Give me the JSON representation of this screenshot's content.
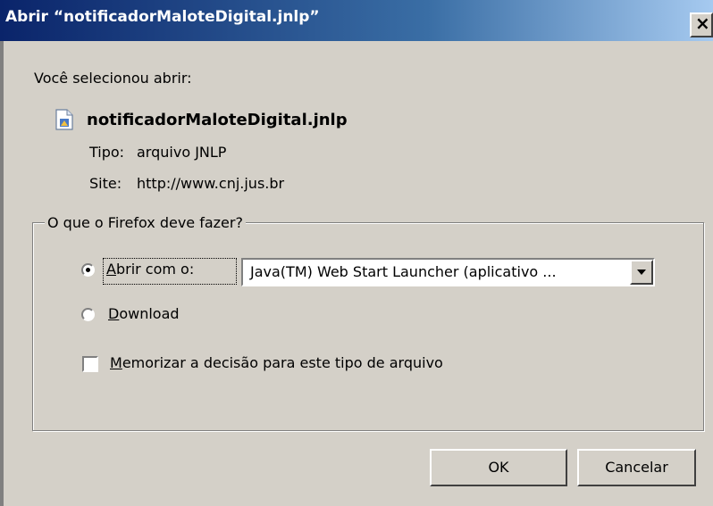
{
  "window": {
    "title": "Abrir “notificadorMaloteDigital.jnlp”"
  },
  "intro": "Você selecionou abrir:",
  "file": {
    "name": "notificadorMaloteDigital.jnlp",
    "type_label": "Tipo:",
    "type_value": "arquivo JNLP",
    "site_label": "Site:",
    "site_value": "http://www.cnj.jus.br"
  },
  "group": {
    "legend": "O que o Firefox deve fazer?"
  },
  "options": {
    "open_with": {
      "accel": "A",
      "rest": "brir com o:",
      "selected": true
    },
    "application": "Java(TM) Web Start Launcher (aplicativo ...",
    "download": {
      "accel": "D",
      "rest": "ownload",
      "selected": false
    },
    "remember": {
      "accel": "M",
      "rest": "emorizar a decisão para este tipo de arquivo",
      "checked": false
    }
  },
  "buttons": {
    "ok": "OK",
    "cancel": "Cancelar"
  },
  "icons": {
    "close": "close-icon",
    "file": "file-icon",
    "dropdown": "chevron-down-icon"
  }
}
